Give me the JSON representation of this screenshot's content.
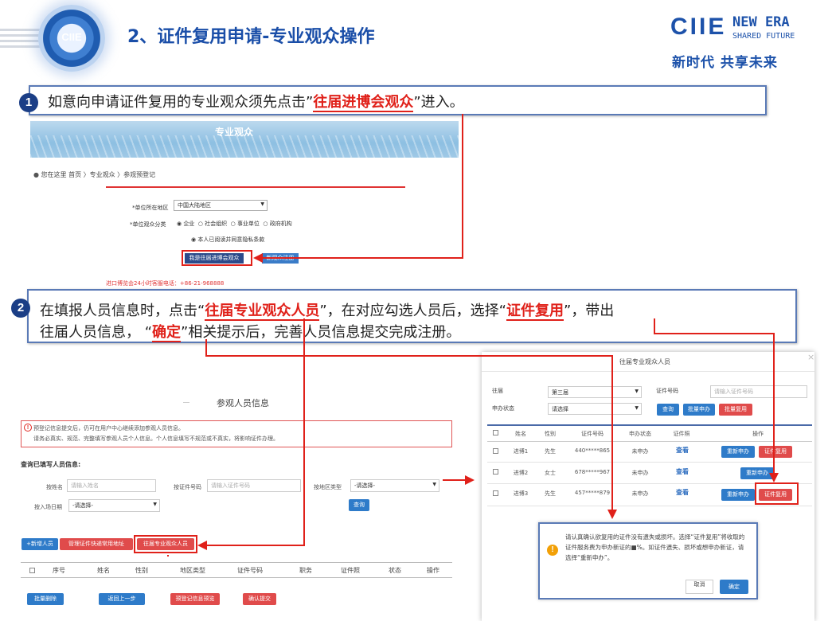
{
  "header": {
    "logo_text": "CIIE",
    "title": "2、证件复用申请-专业观众操作",
    "brand": "CIIE",
    "brand_line1": "NEW ERA",
    "brand_line2": "SHARED FUTURE",
    "slogan": "新时代  共享未来"
  },
  "step1": {
    "number": "1",
    "prefix": "如意向申请证件复用的专业观众须先点击",
    "highlight": "往届进博会观众",
    "suffix": "进入。"
  },
  "step2": {
    "number": "2",
    "line1_a": "在填报人员信息时，点击",
    "line1_hl1": "往届专业观众人员",
    "line1_b": "，在对应勾选人员后，选择",
    "line1_hl2": "证件复用",
    "line1_c": "，带出",
    "line2_a": "往届人员信息，",
    "line2_hl": "确定",
    "line2_b": "相关提示后，完善人员信息提交完成注册。"
  },
  "shot1": {
    "banner_title": "专业观众",
    "breadcrumb": "您在这里  首页 〉专业观众 〉参观预登记",
    "region_label": "*单位所在地区",
    "region_value": "中国大陆地区",
    "category_label": "*单位观众分类",
    "categories": [
      "企业",
      "社会组织",
      "事业单位",
      "政府机构"
    ],
    "privacy": "本人已阅读并同意隐私条款",
    "past_button": "我是往届进博会观众",
    "new_button": "新观众注册",
    "hotline": "进口博览会24小时客服电话：+86-21-968888"
  },
  "shot2": {
    "section_title": "参观人员信息",
    "notice_line1": "预登记信息提交后，仍可在用户中心继续添加参观人员信息。",
    "notice_line2": "请务必真实、规范、完整填写参观人员个人信息。个人信息填写不规范或不真实，将影响证件办理。",
    "query_title": "查询已填写人员信息:",
    "name_label": "按姓名",
    "name_placeholder": "请输入姓名",
    "cert_label": "按证件号码",
    "cert_placeholder": "请输入证件号码",
    "region_label": "按地区类型",
    "region_value": "-请选择-",
    "date_label": "按入场日期",
    "date_value": "-请选择-",
    "query_button": "查询",
    "add_button": "+新增人员",
    "manage_button": "管理证件快递常用地址",
    "past_button": "往届专业观众人员",
    "columns": [
      "序号",
      "姓名",
      "性别",
      "地区类型",
      "证件号码",
      "职务",
      "证件照",
      "状态",
      "操作"
    ],
    "footer_buttons": [
      "批量删除",
      "返回上一步",
      "预登记信息预览",
      "确认提交"
    ]
  },
  "modal": {
    "title": "往届专业观众人员",
    "close": "×",
    "session_label": "往届",
    "session_value": "第三届",
    "status_label": "申办状态",
    "status_value": "请选择",
    "cert_label": "证件号码",
    "cert_placeholder": "请输入证件号码",
    "query_button": "查询",
    "batch_apply": "批量申办",
    "batch_reuse": "批量复用",
    "columns": [
      "姓名",
      "性别",
      "证件号码",
      "申办状态",
      "证件照",
      "操作"
    ],
    "rows": [
      {
        "name": "进博1",
        "gender": "先生",
        "cert": "440*****865",
        "status": "未申办",
        "photo": "查看",
        "ops": [
          "重新申办",
          "证件复用"
        ]
      },
      {
        "name": "进博2",
        "gender": "女士",
        "cert": "678*****967",
        "status": "未申办",
        "photo": "查看",
        "ops": [
          "重新申办"
        ]
      },
      {
        "name": "进博3",
        "gender": "先生",
        "cert": "457*****879",
        "status": "未申办",
        "photo": "查看",
        "ops": [
          "重新申办",
          "证件复用"
        ]
      }
    ]
  },
  "confirm": {
    "message": "请认真确认欲复用的证件没有遗失或损坏。选择“证件复用”将收取的证件服务费为申办新证的■%。如证件遗失、损坏或想申办新证，请选择“重新申办”。",
    "cancel": "取消",
    "ok": "确定"
  }
}
